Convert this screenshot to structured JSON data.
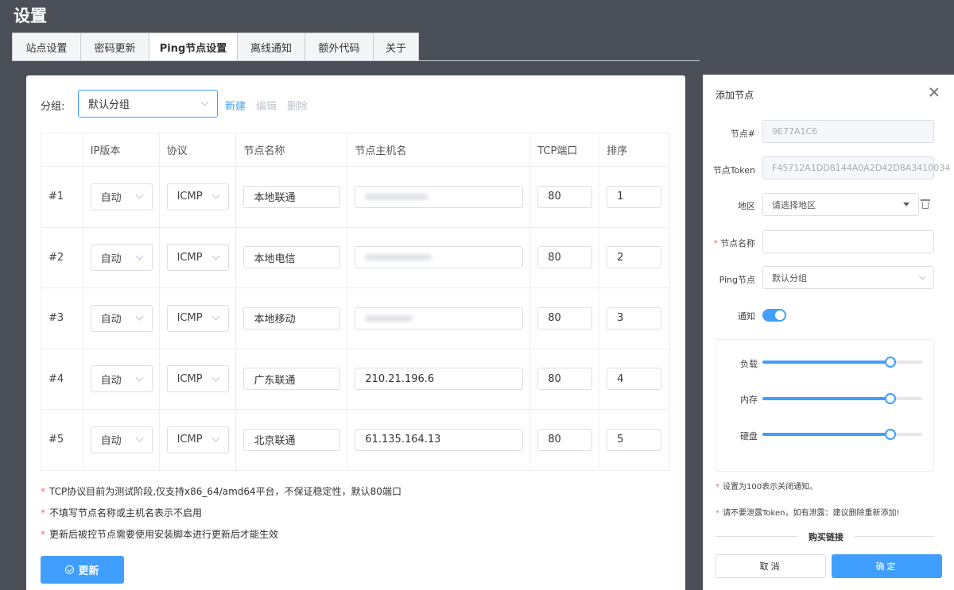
{
  "page_title": "设置",
  "tabs": [
    {
      "label": "站点设置",
      "active": false
    },
    {
      "label": "密码更新",
      "active": false
    },
    {
      "label": "Ping节点设置",
      "active": true
    },
    {
      "label": "离线通知",
      "active": false
    },
    {
      "label": "额外代码",
      "active": false
    },
    {
      "label": "关于",
      "active": false
    }
  ],
  "group": {
    "label": "分组:",
    "selected": "默认分组",
    "new_label": "新建",
    "edit_label": "编辑",
    "delete_label": "删除"
  },
  "table": {
    "headers": [
      "",
      "IP版本",
      "协议",
      "节点名称",
      "节点主机名",
      "TCP端口",
      "排序"
    ],
    "rows": [
      {
        "index": "#1",
        "ip_version": "自动",
        "protocol": "ICMP",
        "name": "本地联通",
        "host": "",
        "host_blurred": true,
        "port": "80",
        "order": "1"
      },
      {
        "index": "#2",
        "ip_version": "自动",
        "protocol": "ICMP",
        "name": "本地电信",
        "host": "",
        "host_blurred": true,
        "port": "80",
        "order": "2"
      },
      {
        "index": "#3",
        "ip_version": "自动",
        "protocol": "ICMP",
        "name": "本地移动",
        "host": "",
        "host_blurred": true,
        "port": "80",
        "order": "3"
      },
      {
        "index": "#4",
        "ip_version": "自动",
        "protocol": "ICMP",
        "name": "广东联通",
        "host": "210.21.196.6",
        "host_blurred": false,
        "port": "80",
        "order": "4"
      },
      {
        "index": "#5",
        "ip_version": "自动",
        "protocol": "ICMP",
        "name": "北京联通",
        "host": "61.135.164.13",
        "host_blurred": false,
        "port": "80",
        "order": "5"
      }
    ]
  },
  "notes": [
    "TCP协议目前为测试阶段,仅支持x86_64/amd64平台，不保证稳定性，默认80端口",
    "不填写节点名称或主机名表示不启用",
    "更新后被控节点需要使用安装脚本进行更新后才能生效"
  ],
  "update_button": "更新",
  "drawer": {
    "title": "添加节点",
    "fields": {
      "node_id_label": "节点#",
      "node_id_value": "9E77A1C6",
      "token_label": "节点Token",
      "token_value": "F45712A1DD8144A0A2D42D8A3410034",
      "region_label": "地区",
      "region_placeholder": "请选择地区",
      "name_label": "节点名称",
      "name_value": "",
      "ping_label": "Ping节点",
      "ping_value": "默认分组",
      "notify_label": "通知",
      "notify_on": true
    },
    "sliders": [
      {
        "label": "负载",
        "value": 80
      },
      {
        "label": "内存",
        "value": 80
      },
      {
        "label": "硬盘",
        "value": 80
      }
    ],
    "note1": "设置为100表示关闭通知。",
    "note2": "请不要泄露Token，如有泄露：建议删除重新添加!",
    "divider_text": "购买链接",
    "cancel_label": "取消",
    "ok_label": "确定"
  },
  "colors": {
    "primary": "#409eff",
    "background": "#4b5058",
    "required_star": "#f56c6c"
  }
}
